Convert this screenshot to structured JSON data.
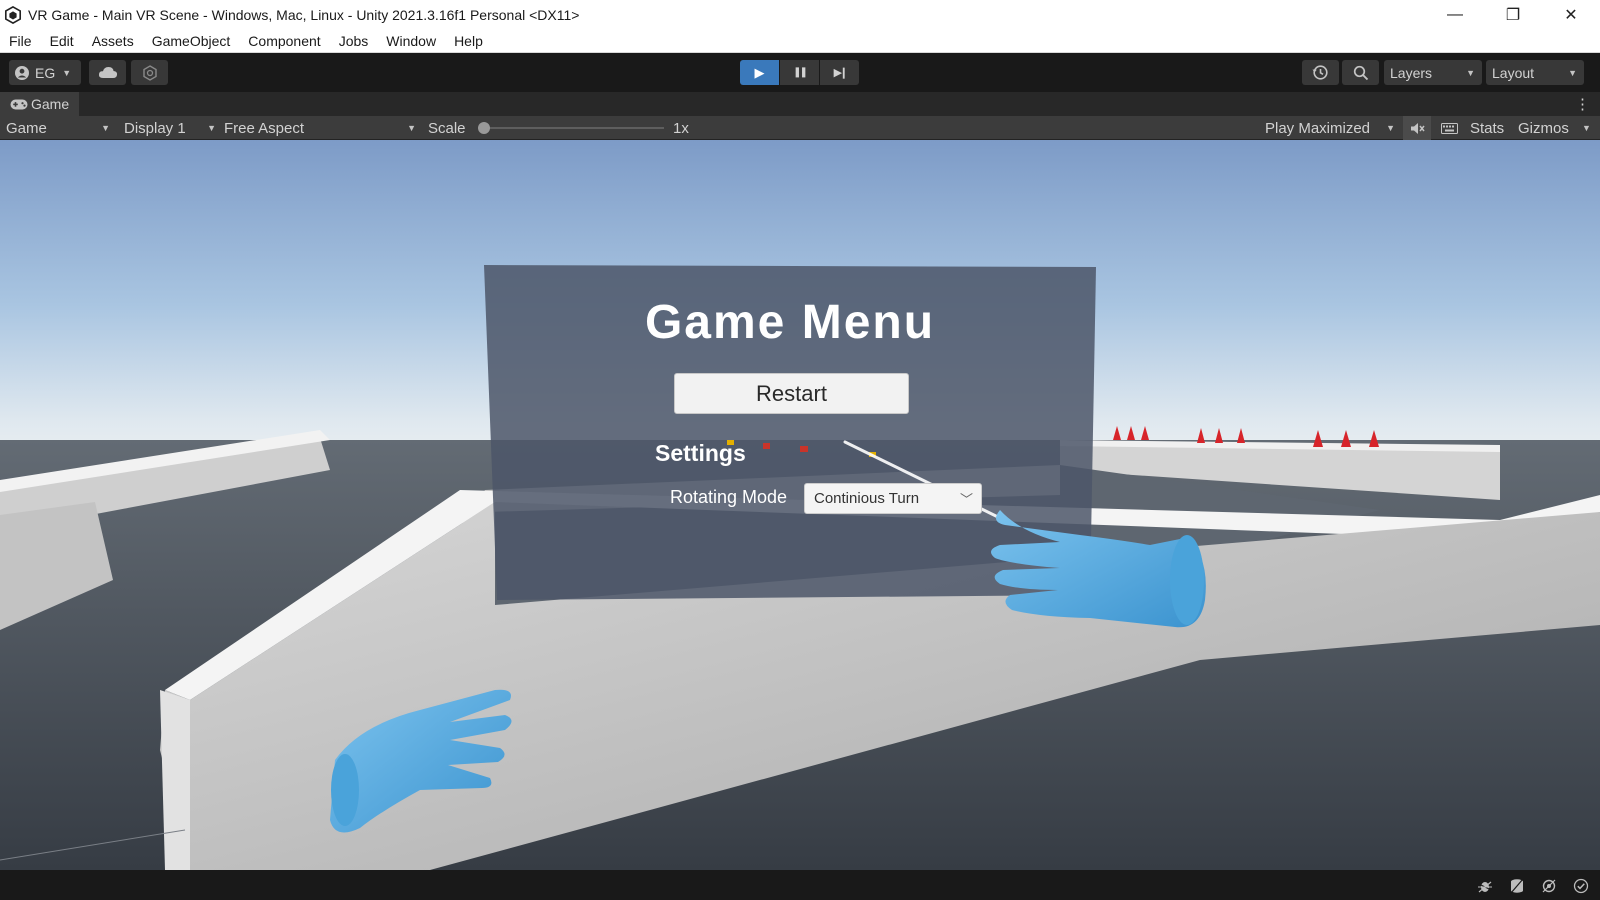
{
  "window": {
    "title": "VR Game - Main VR Scene - Windows, Mac, Linux - Unity 2021.3.16f1 Personal <DX11>",
    "icon": "unity-logo-icon",
    "controls": {
      "minimize": "—",
      "restore": "❐",
      "close": "✕"
    }
  },
  "menubar": {
    "items": [
      "File",
      "Edit",
      "Assets",
      "GameObject",
      "Component",
      "Jobs",
      "Window",
      "Help"
    ]
  },
  "toolbar": {
    "account_label": "EG",
    "play_icon": "▶",
    "pause_icon": "❚❚",
    "step_icon": "▶❙",
    "layers_label": "Layers",
    "layout_label": "Layout",
    "accent": "#3a79bb"
  },
  "game_tab": {
    "label": "Game",
    "more": "⋮"
  },
  "game_controls": {
    "view_mode": "Game",
    "display": "Display 1",
    "aspect": "Free Aspect",
    "scale_label": "Scale",
    "scale_value": "1x",
    "play_mode": "Play Maximized",
    "stats_label": "Stats",
    "gizmos_label": "Gizmos"
  },
  "game_menu": {
    "title": "Game Menu",
    "restart_label": "Restart",
    "settings_heading": "Settings",
    "rotating_mode_label": "Rotating Mode",
    "rotating_mode_value": "Continious Turn"
  },
  "colors": {
    "hand": "#5aaee0",
    "sky_top": "#7a9cc8",
    "wall": "#d8d8d8",
    "panel": "#4a5566"
  }
}
